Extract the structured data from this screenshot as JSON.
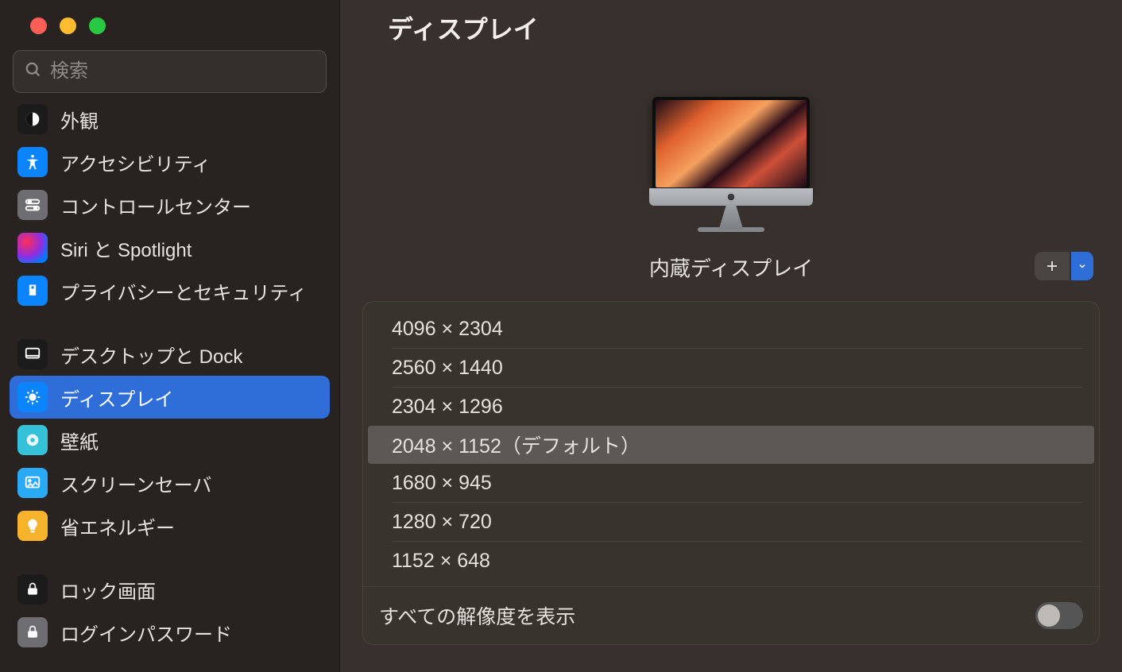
{
  "header": {
    "title": "ディスプレイ"
  },
  "search": {
    "placeholder": "検索"
  },
  "sidebar": {
    "items": [
      {
        "label": "外観"
      },
      {
        "label": "アクセシビリティ"
      },
      {
        "label": "コントロールセンター"
      },
      {
        "label": "Siri と Spotlight"
      },
      {
        "label": "プライバシーとセキュリティ"
      },
      {
        "label": "デスクトップと Dock"
      },
      {
        "label": "ディスプレイ"
      },
      {
        "label": "壁紙"
      },
      {
        "label": "スクリーンセーバ"
      },
      {
        "label": "省エネルギー"
      },
      {
        "label": "ロック画面"
      },
      {
        "label": "ログインパスワード"
      }
    ]
  },
  "display": {
    "name": "内蔵ディスプレイ",
    "default_suffix": "（デフォルト）",
    "resolutions": [
      "4096 × 2304",
      "2560 × 1440",
      "2304 × 1296",
      "2048 × 1152（デフォルト）",
      "1680 × 945",
      "1280 × 720",
      "1152 × 648"
    ],
    "selected_index": 3,
    "show_all_label": "すべての解像度を表示",
    "show_all_on": false
  },
  "colors": {
    "accent": "#2f6ed9"
  }
}
